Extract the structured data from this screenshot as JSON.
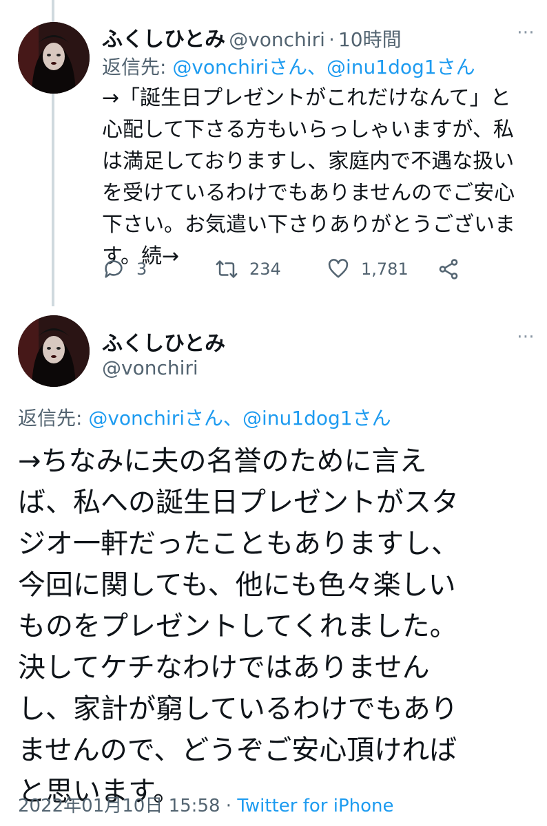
{
  "tweet1": {
    "name": "ふくしひとみ",
    "handle": "@vonchiri",
    "separator": "·",
    "time": "10時間",
    "reply_prefix": "返信先: ",
    "reply_user1": "@vonchiriさん",
    "reply_sep": "、",
    "reply_user2": "@inu1dog1さん",
    "lines": [
      "→「誕生日プレゼントがこれだけなんて」と",
      "心配して下さる方もいらっしゃいますが、私",
      "は満足しておりますし、家庭内で不遇な扱い",
      "を受けているわけでもありませんのでご安心",
      "下さい。お気遣い下さりありがとうございま",
      "す。続→"
    ],
    "replies": "3",
    "retweets": "234",
    "likes": "1,781"
  },
  "tweet2": {
    "name": "ふくしひとみ",
    "handle": "@vonchiri",
    "reply_prefix": "返信先: ",
    "reply_user1": "@vonchiriさん",
    "reply_sep": "、",
    "reply_user2": "@inu1dog1さん",
    "lines": [
      "→ちなみに夫の名誉のために言え",
      "ば、私への誕生日プレゼントがスタ",
      "ジオ一軒だったこともありますし、",
      "今回に関しても、他にも色々楽しい",
      "ものをプレゼントしてくれました。",
      "決してケチなわけではありません",
      "し、家計が窮しているわけでもあり",
      "ませんので、どうぞご安心頂ければ",
      "と思います。"
    ],
    "date": "2022年01月10日 15:58",
    "separator": "·",
    "source": "Twitter for iPhone"
  },
  "icons": {
    "reply": "reply-icon",
    "retweet": "retweet-icon",
    "like": "heart-icon",
    "share": "share-icon",
    "more": "more-icon"
  },
  "colors": {
    "link": "#1d9bf0",
    "muted": "#536471",
    "text": "#0f1419",
    "thread_line": "#cfd9de"
  }
}
